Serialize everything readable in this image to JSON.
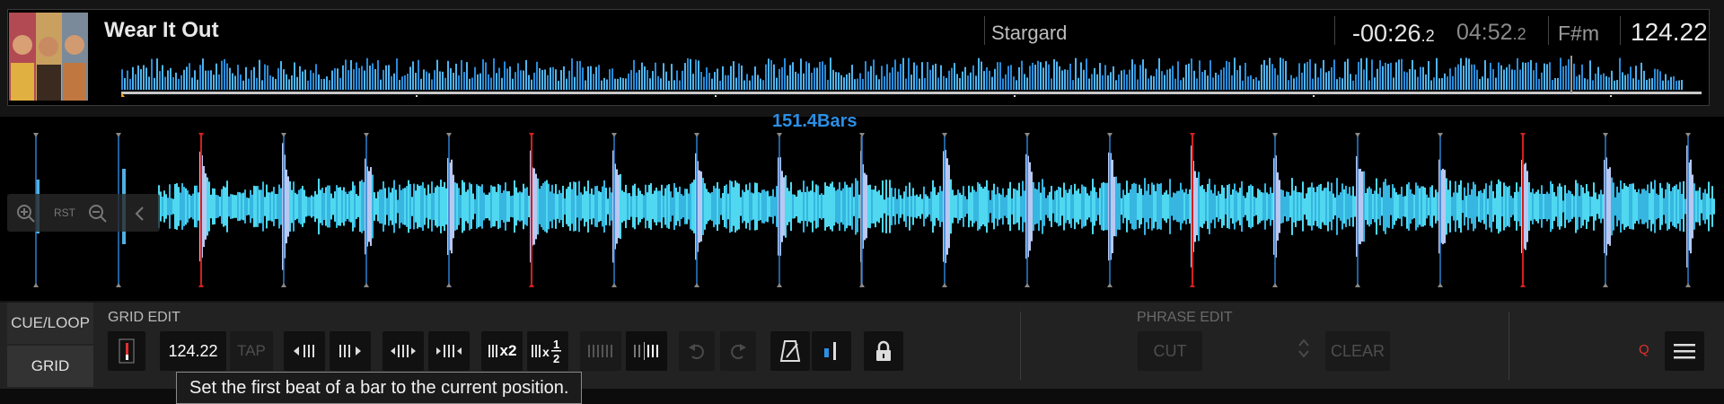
{
  "track": {
    "title": "Wear It Out",
    "artist": "Stargard",
    "remaining_main": "-00:26",
    "remaining_frac": ".2",
    "total_main": "04:52",
    "total_frac": ".2",
    "key": "F#m",
    "bpm": "124.22"
  },
  "waveform": {
    "bars_label": "151.4Bars",
    "zoom_reset_label": "RST"
  },
  "tabs": {
    "cue_loop": "CUE/LOOP",
    "grid": "GRID"
  },
  "grid_edit": {
    "section_label": "GRID EDIT",
    "bpm_value": "124.22",
    "tap_label": "TAP",
    "x2_label": "x2"
  },
  "phrase_edit": {
    "section_label": "PHRASE EDIT",
    "cut_label": "CUT",
    "clear_label": "CLEAR"
  },
  "quantize_label": "Q",
  "tooltip": "Set the first beat of a bar to the current position.",
  "colors": {
    "accent_blue": "#2c8fe6",
    "beat_line": "#2a7fd0",
    "bar_line": "#d02020",
    "waveform_cyan": "#4fd8f0",
    "quantize_red": "#e03030"
  }
}
